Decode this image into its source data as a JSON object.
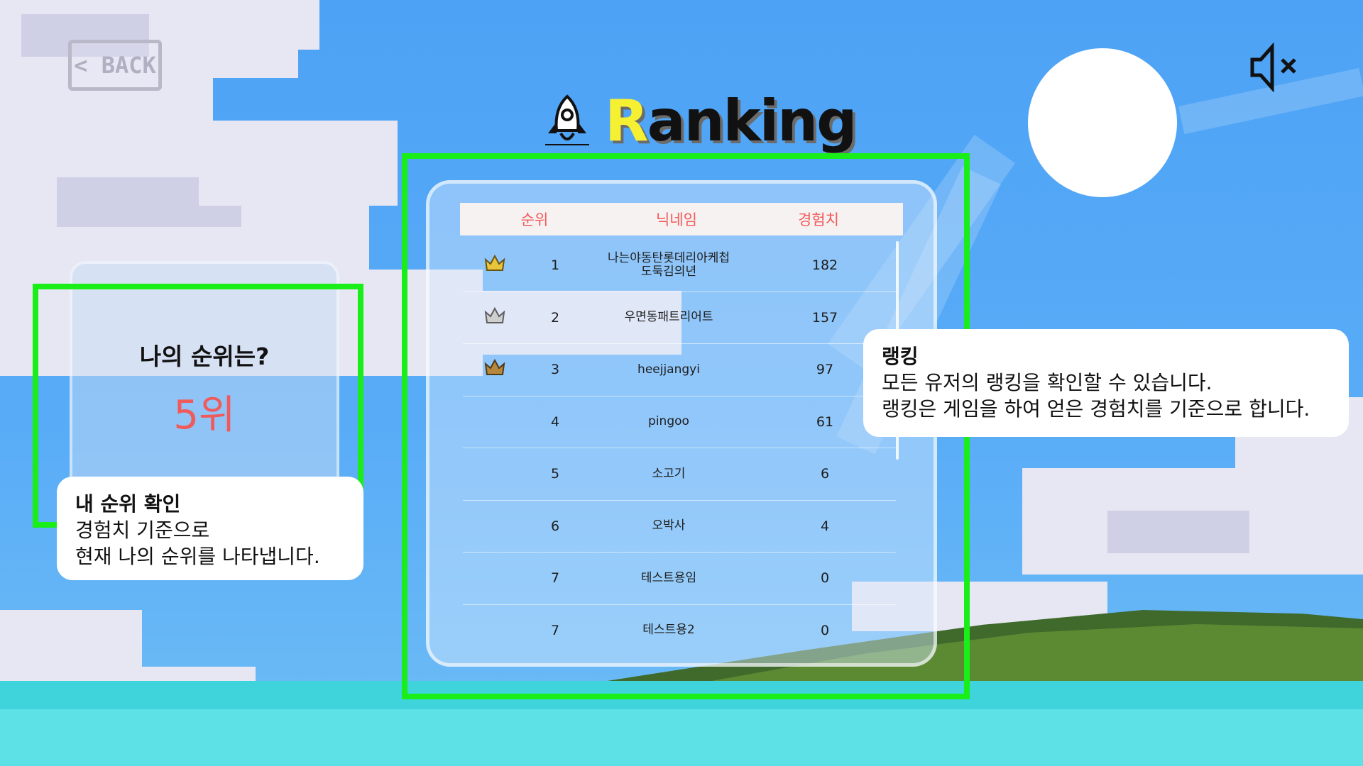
{
  "header": {
    "back_label": "< BACK",
    "title_first_letter": "R",
    "title_rest": "anking",
    "mute_icon": "speaker-muted-icon"
  },
  "ranking": {
    "columns": [
      "순위",
      "닉네임",
      "경험치"
    ],
    "rows": [
      {
        "rank": "1",
        "name": "나는야동탄롯데리아케첩도둑김의년",
        "name_line1": "나는야동탄롯데리아케첩",
        "name_line2": "도둑김의년",
        "exp": "182",
        "crown": "gold"
      },
      {
        "rank": "2",
        "name": "우면동패트리어트",
        "exp": "157",
        "crown": "silver"
      },
      {
        "rank": "3",
        "name": "heejjangyi",
        "exp": "97",
        "crown": "bronze"
      },
      {
        "rank": "4",
        "name": "pingoo",
        "exp": "61"
      },
      {
        "rank": "5",
        "name": "소고기",
        "exp": "6"
      },
      {
        "rank": "6",
        "name": "오박사",
        "exp": "4"
      },
      {
        "rank": "7",
        "name": "테스트용임",
        "exp": "0"
      },
      {
        "rank": "7",
        "name": "테스트용2",
        "exp": "0"
      }
    ],
    "crown_colors": {
      "gold": "#e8c53a",
      "silver": "#cfcfcf",
      "bronze": "#b7873e"
    }
  },
  "my_rank": {
    "title": "나의 순위는?",
    "value": "5위"
  },
  "tooltips": {
    "my_rank": {
      "title": "내 순위 확인",
      "line1": "경험치 기준으로",
      "line2": "현재 나의 순위를 나타냅니다."
    },
    "ranking": {
      "title": "랭킹",
      "line1": "모든 유저의 랭킹을 확인할 수 있습니다.",
      "line2": "랭킹은 게임을 하여 얻은 경험치를 기준으로 합니다."
    }
  },
  "colors": {
    "highlight": "#19ee18",
    "accent_red": "#f25a5a",
    "title_yellow": "#f6f033"
  }
}
